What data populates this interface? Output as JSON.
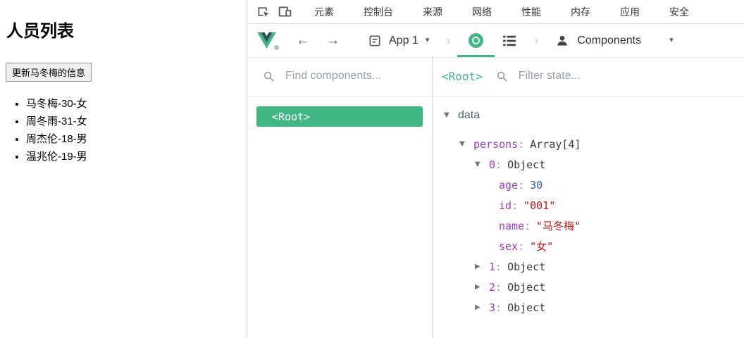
{
  "page": {
    "title": "人员列表",
    "update_button": "更新马冬梅的信息",
    "list": [
      "马冬梅-30-女",
      "周冬雨-31-女",
      "周杰伦-18-男",
      "温兆伦-19-男"
    ]
  },
  "devtools": {
    "tabs": [
      "元素",
      "控制台",
      "来源",
      "网络",
      "性能",
      "内存",
      "应用",
      "安全"
    ],
    "toolbar": {
      "app_name": "App 1",
      "inspector_name": "Components"
    },
    "components": {
      "search_placeholder": "Find components...",
      "root": "<Root>"
    },
    "state": {
      "title": "<Root>",
      "filter_placeholder": "Filter state...",
      "section": "data",
      "colon": ":",
      "persons_key": "persons",
      "persons_type": "Array[4]",
      "object_type": "Object",
      "objects": [
        {
          "index": "0"
        },
        {
          "index": "1"
        },
        {
          "index": "2"
        },
        {
          "index": "3"
        }
      ],
      "props": [
        {
          "key": "age",
          "value": "30"
        },
        {
          "key": "id",
          "value": "\"001\""
        },
        {
          "key": "name",
          "value": "\"马冬梅\""
        },
        {
          "key": "sex",
          "value": "\"女\""
        }
      ]
    },
    "icons": {
      "expanded": "▼",
      "collapsed": "▶",
      "caret_down": "▾",
      "chevron": "›",
      "back": "←",
      "forward": "→"
    },
    "colors": {
      "accent_green": "#41b883",
      "key_purple": "#a13cc5",
      "number_blue": "#2c52d9",
      "string_red": "#c41a16"
    }
  }
}
